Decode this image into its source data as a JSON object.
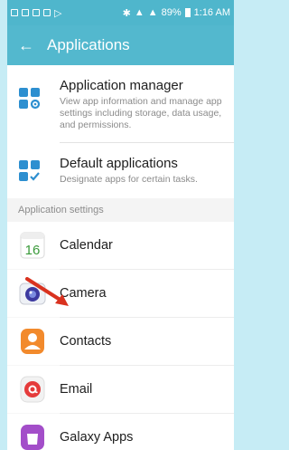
{
  "status_bar": {
    "battery": "89%",
    "time": "1:16 AM"
  },
  "header": {
    "title": "Applications"
  },
  "entries": [
    {
      "title": "Application manager",
      "description": "View app information and manage app settings including storage, data usage, and permissions."
    },
    {
      "title": "Default applications",
      "description": "Designate apps for certain tasks."
    }
  ],
  "section": {
    "label": "Application settings"
  },
  "apps": [
    {
      "label": "Calendar",
      "icon": "calendar-icon",
      "icon_text": "16"
    },
    {
      "label": "Camera",
      "icon": "camera-icon"
    },
    {
      "label": "Contacts",
      "icon": "contacts-icon"
    },
    {
      "label": "Email",
      "icon": "email-icon"
    },
    {
      "label": "Galaxy Apps",
      "icon": "galaxy-apps-icon"
    }
  ],
  "colors": {
    "header": "#53b8ce",
    "status_bar": "#4fb6cc",
    "accent": "#2d8fd0",
    "annotation_arrow": "#d9321f"
  }
}
